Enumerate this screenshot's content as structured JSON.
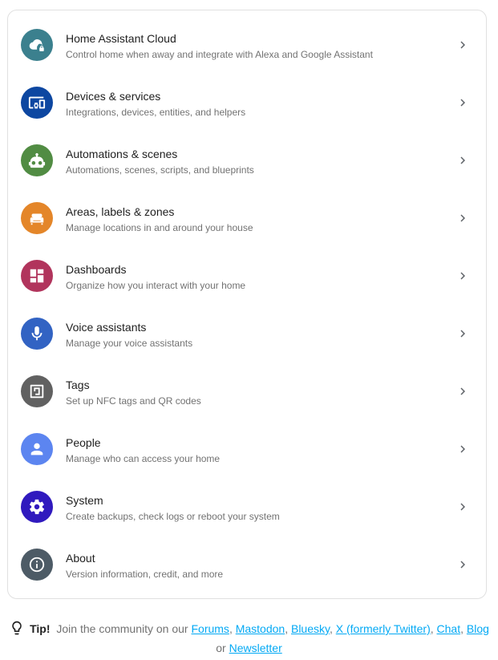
{
  "menu": {
    "items": [
      {
        "title": "Home Assistant Cloud",
        "description": "Control home when away and integrate with Alexa and Google Assistant",
        "icon": "cloud-lock-icon",
        "color": "#3b808e"
      },
      {
        "title": "Devices & services",
        "description": "Integrations, devices, entities, and helpers",
        "icon": "devices-icon",
        "color": "#0d47a1"
      },
      {
        "title": "Automations & scenes",
        "description": "Automations, scenes, scripts, and blueprints",
        "icon": "robot-icon",
        "color": "#518c43"
      },
      {
        "title": "Areas, labels & zones",
        "description": "Manage locations in and around your house",
        "icon": "sofa-icon",
        "color": "#e48629"
      },
      {
        "title": "Dashboards",
        "description": "Organize how you interact with your home",
        "icon": "dashboard-icon",
        "color": "#b1345c"
      },
      {
        "title": "Voice assistants",
        "description": "Manage your voice assistants",
        "icon": "microphone-icon",
        "color": "#3263c3"
      },
      {
        "title": "Tags",
        "description": "Set up NFC tags and QR codes",
        "icon": "nfc-tag-icon",
        "color": "#616161"
      },
      {
        "title": "People",
        "description": "Manage who can access your home",
        "icon": "person-icon",
        "color": "#5c85f0"
      },
      {
        "title": "System",
        "description": "Create backups, check logs or reboot your system",
        "icon": "gear-icon",
        "color": "#301abe"
      },
      {
        "title": "About",
        "description": "Version information, credit, and more",
        "icon": "info-icon",
        "color": "#4d5b66"
      }
    ]
  },
  "tip": {
    "label": "Tip!",
    "text": "Join the community on our",
    "links": [
      "Forums",
      "Mastodon",
      "Bluesky",
      "X (formerly Twitter)",
      "Chat",
      "Blog"
    ],
    "or": "or",
    "last_link": "Newsletter",
    "link_color": "#03a9f4"
  }
}
